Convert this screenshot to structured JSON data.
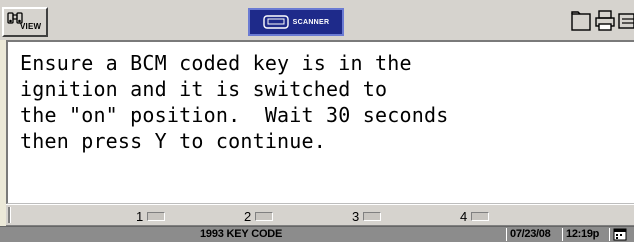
{
  "toolbar": {
    "view_label": "VIEW",
    "scanner_label": "SCANNER",
    "icons": [
      "binoculars-icon",
      "keyboard-icon",
      "folder-icon",
      "printer-icon",
      "drive-icon"
    ]
  },
  "message": {
    "lines": [
      "Ensure a BCM coded key is in the",
      "ignition and it is switched to",
      "the \"on\" position.  Wait 30 seconds",
      "then press Y to continue."
    ]
  },
  "softkeys": [
    {
      "label": "1"
    },
    {
      "label": "2"
    },
    {
      "label": "3"
    },
    {
      "label": "4"
    }
  ],
  "status": {
    "title": "1993 KEY CODE",
    "date": "07/23/08",
    "time": "12:19p"
  },
  "colors": {
    "scanner_bg": "#1e2a8a",
    "status_bg": "#8c8c8c",
    "panel_bg": "#ffffff"
  }
}
